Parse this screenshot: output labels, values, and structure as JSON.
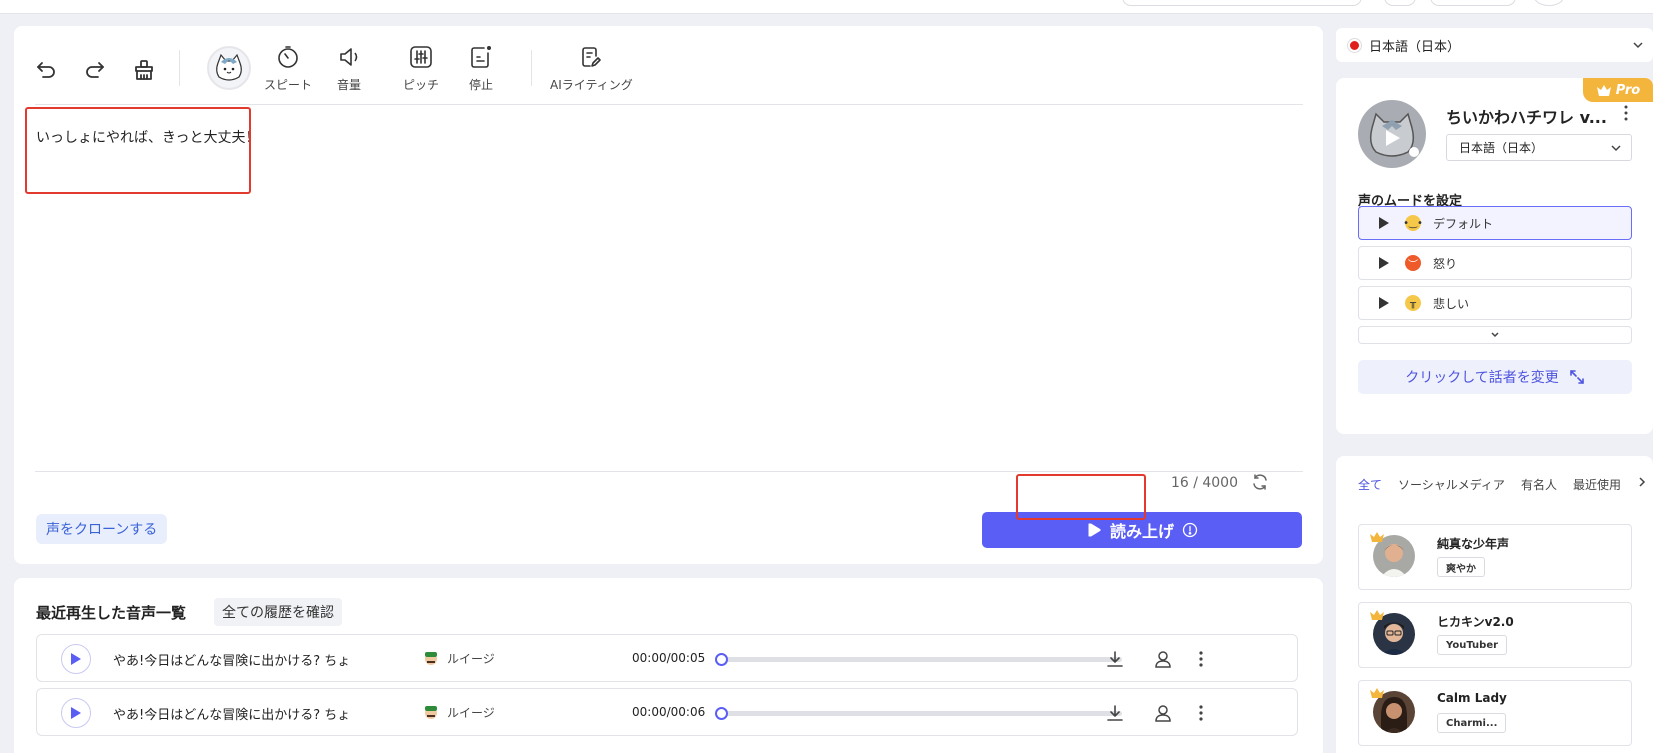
{
  "toolbar": {
    "tools": [
      {
        "label": "スピート",
        "icon": "speed-icon"
      },
      {
        "label": "音量",
        "icon": "volume-icon"
      },
      {
        "label": "ピッチ",
        "icon": "pitch-icon"
      },
      {
        "label": "停止",
        "icon": "pause-icon"
      },
      {
        "label": "AIライティング",
        "icon": "ai-writing-icon"
      }
    ]
  },
  "editor": {
    "text": "いっしょにやれば、きっと大丈夫！",
    "counter": "16 / 4000",
    "clone_label": "声をクローンする",
    "read_label": "読み上げ"
  },
  "history": {
    "title": "最近再生した音声一覧",
    "view_all": "全ての履歴を確認",
    "rows": [
      {
        "text": "やあ!今日はどんな冒険に出かける? ちょ",
        "speaker": "ルイージ",
        "time": "00:00/00:05",
        "progress": 0
      },
      {
        "text": "やあ!今日はどんな冒険に出かける? ちょ",
        "speaker": "ルイージ",
        "time": "00:00/00:06",
        "progress": 0
      }
    ]
  },
  "language": {
    "selected": "日本語（日本）"
  },
  "speaker": {
    "badge": "Pro",
    "name": "ちいかわハチワレ v...",
    "language": "日本語（日本）",
    "mood_title": "声のムードを設定",
    "moods": [
      {
        "label": "デフォルト",
        "selected": true,
        "color": "#f6c84a"
      },
      {
        "label": "怒り",
        "selected": false,
        "color": "#ee5a2a"
      },
      {
        "label": "悲しい",
        "selected": false,
        "color": "#f6c84a"
      }
    ],
    "change_label": "クリックして話者を変更"
  },
  "voice_list": {
    "tabs": [
      "全て",
      "ソーシャルメディア",
      "有名人",
      "最近使用"
    ],
    "active_tab": "全て",
    "voices": [
      {
        "name": "純真な少年声",
        "tag": "爽やか"
      },
      {
        "name": "ヒカキンv2.0",
        "tag": "YouTuber"
      },
      {
        "name": "Calm Lady",
        "tag": "Charmi..."
      }
    ]
  },
  "colors": {
    "accent": "#5b5ef5",
    "highlight": "#e23a2e",
    "pro": "#f4b53d"
  }
}
